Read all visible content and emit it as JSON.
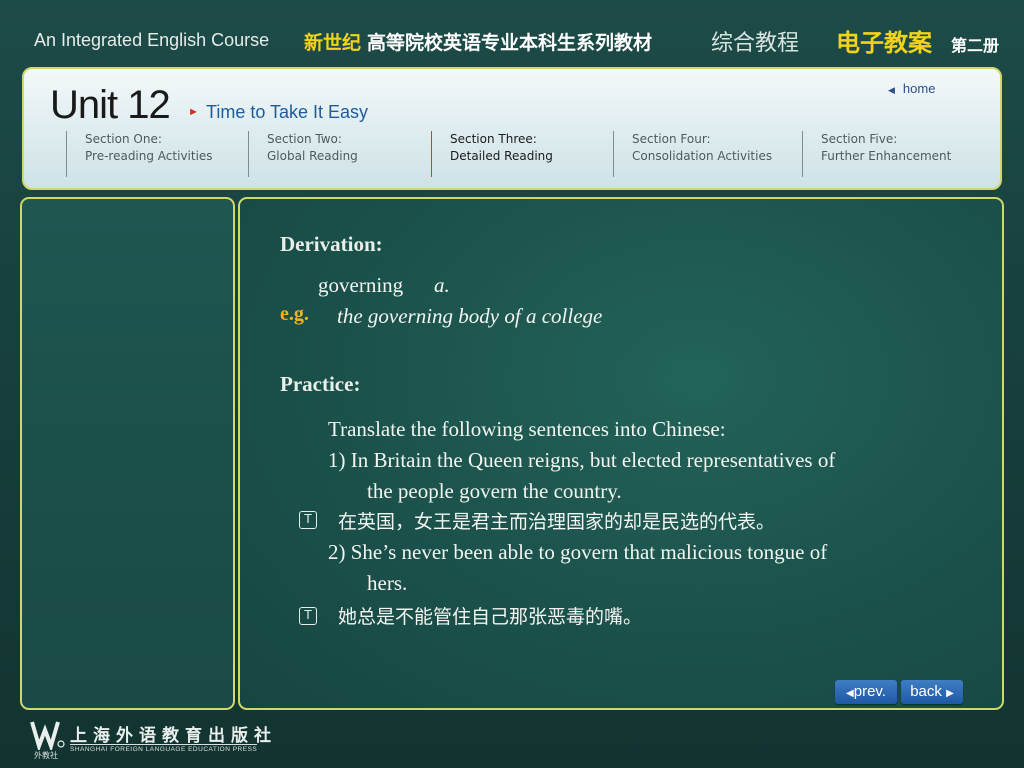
{
  "banner": {
    "course_title": "An Integrated English Course",
    "cn_series_yellow": "新世纪",
    "cn_series_white": "高等院校英语专业本科生系列教材",
    "cn_zonghe": "综合教程",
    "cn_dianzi": "电子教案",
    "cn_volume": "第二册"
  },
  "header": {
    "unit_title": "Unit 12",
    "unit_subtitle": "Time to Take It Easy",
    "home_label": "home",
    "sections": [
      {
        "line1": "Section One:",
        "line2": "Pre-reading Activities",
        "active": false
      },
      {
        "line1": "Section Two:",
        "line2": "Global Reading",
        "active": false
      },
      {
        "line1": "Section Three:",
        "line2": "Detailed Reading",
        "active": true
      },
      {
        "line1": "Section Four:",
        "line2": "Consolidation Activities",
        "active": false
      },
      {
        "line1": "Section Five:",
        "line2": "Further Enhancement",
        "active": false
      }
    ]
  },
  "content": {
    "derivation_heading": "Derivation:",
    "derivation_word": "governing",
    "derivation_pos": "a.",
    "eg_label": "e.g.",
    "eg_text": "the governing body of a college",
    "practice_heading": "Practice:",
    "instruction": "Translate the following sentences into Chinese:",
    "q1_line1": "1)   In Britain the Queen reigns, but elected representatives of",
    "q1_line2": "the people govern the country.",
    "a1": "在英国，女王是君主而治理国家的却是民选的代表。",
    "q2_line1": "2)  She’s never been able to govern that malicious tongue of",
    "q2_line2": "hers.",
    "a2": "她总是不能管住自己那张恶毒的嘴。",
    "t_icon_glyph": "T"
  },
  "nav": {
    "prev_label": "prev.",
    "back_label": "back"
  },
  "publisher": {
    "name_cn": "上海外语教育出版社",
    "name_en": "SHANGHAI FOREIGN LANGUAGE EDUCATION PRESS",
    "short_cn": "外教社"
  },
  "colors": {
    "accent_yellow": "#f2d21a",
    "border_yellow": "#cfd86a",
    "background_green": "#1b514b",
    "button_blue": "#1f58a6"
  }
}
